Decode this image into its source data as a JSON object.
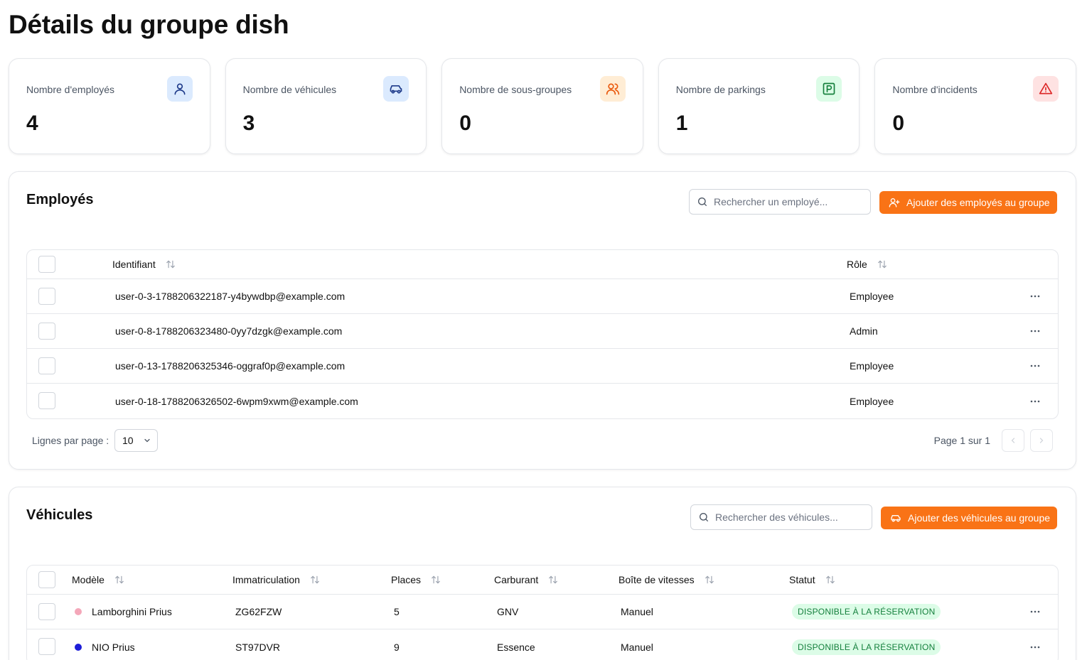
{
  "page": {
    "title": "Détails du groupe dish"
  },
  "stats": [
    {
      "label": "Nombre d'employés",
      "value": "4",
      "icon": "user-icon",
      "color": "#1e3a8a",
      "bg": "#dbeafe"
    },
    {
      "label": "Nombre de véhicules",
      "value": "3",
      "icon": "car-icon",
      "color": "#1e3a8a",
      "bg": "#dbeafe"
    },
    {
      "label": "Nombre de sous-groupes",
      "value": "0",
      "icon": "users-icon",
      "color": "#ea580c",
      "bg": "#ffedd5"
    },
    {
      "label": "Nombre de parkings",
      "value": "1",
      "icon": "parking-icon",
      "color": "#15803d",
      "bg": "#dcfce7"
    },
    {
      "label": "Nombre d'incidents",
      "value": "0",
      "icon": "alert-triangle-icon",
      "color": "#dc2626",
      "bg": "#fee2e2"
    }
  ],
  "employees": {
    "title": "Employés",
    "search_placeholder": "Rechercher un employé...",
    "add_label": "Ajouter des employés au groupe",
    "columns": {
      "id": "Identifiant",
      "role": "Rôle"
    },
    "rows": [
      {
        "id": "user-0-3-1788206322187-y4bywdbp@example.com",
        "role": "Employee"
      },
      {
        "id": "user-0-8-1788206323480-0yy7dzgk@example.com",
        "role": "Admin"
      },
      {
        "id": "user-0-13-1788206325346-oggraf0p@example.com",
        "role": "Employee"
      },
      {
        "id": "user-0-18-1788206326502-6wpm9xwm@example.com",
        "role": "Employee"
      }
    ],
    "rows_per_page_label": "Lignes par page :",
    "rows_per_page": "10",
    "page_info": "Page 1 sur 1"
  },
  "vehicles": {
    "title": "Véhicules",
    "search_placeholder": "Rechercher des véhicules...",
    "add_label": "Ajouter des véhicules au groupe",
    "columns": {
      "model": "Modèle",
      "plate": "Immatriculation",
      "seats": "Places",
      "fuel": "Carburant",
      "gearbox": "Boîte de vitesses",
      "status": "Statut"
    },
    "rows": [
      {
        "model": "Lamborghini Prius",
        "color": "#f4a7b9",
        "plate": "ZG62FZW",
        "seats": "5",
        "fuel": "GNV",
        "gearbox": "Manuel",
        "status": "DISPONIBLE À LA RÉSERVATION"
      },
      {
        "model": "NIO Prius",
        "color": "#1d1dd8",
        "plate": "ST97DVR",
        "seats": "9",
        "fuel": "Essence",
        "gearbox": "Manuel",
        "status": "DISPONIBLE À LA RÉSERVATION"
      }
    ]
  },
  "colors": {
    "accent": "#f97316",
    "status_bg": "#dcfce7",
    "status_text": "#15803d"
  }
}
